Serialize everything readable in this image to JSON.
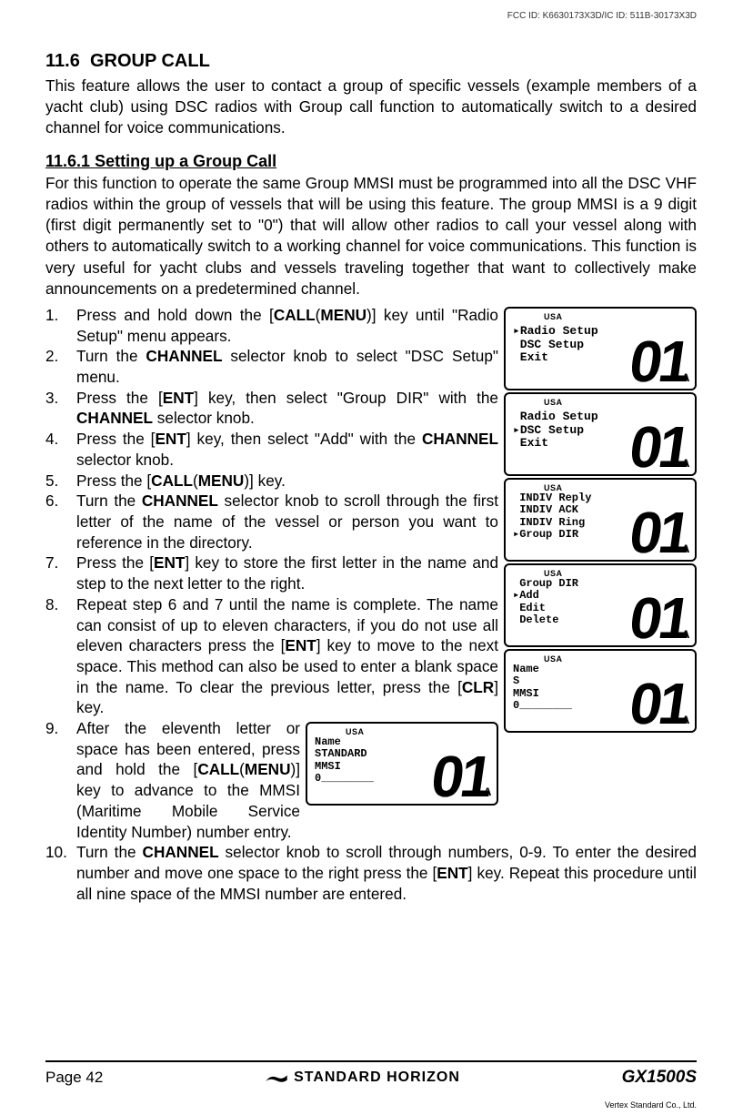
{
  "fcc_id": "FCC ID: K6630173X3D/IC ID: 511B-30173X3D",
  "section": {
    "number": "11.6",
    "title": "GROUP CALL",
    "intro": "This feature allows the user to contact a group of specific vessels (example members of a yacht club) using DSC radios with Group call function to automatically switch to a desired channel for voice communications."
  },
  "subsection": {
    "number": "11.6.1",
    "title": "Setting up a Group Call",
    "intro": "For this function to operate the same Group MMSI must be programmed into all the DSC VHF radios within the group of vessels that will be using this feature. The group MMSI is a 9 digit (first digit permanently set to \"0\") that will allow other radios to call your vessel along with others to automatically switch to a working channel for voice communications. This function is very useful for yacht clubs and vessels traveling together that want to collectively make announcements on a predetermined channel."
  },
  "keys": {
    "call_menu": "CALL",
    "menu_paren": "MENU",
    "ent": "ENT",
    "channel": "CHANNEL",
    "clr": "CLR"
  },
  "menu_labels": {
    "radio_setup": "Radio Setup",
    "dsc_setup": "DSC Setup",
    "group_dir": "Group DIR",
    "add": "Add"
  },
  "steps": {
    "s1a": "Press and hold down the [",
    "s1b": ")] key until \"",
    "s1c": "\" menu appears.",
    "s2a": "Turn the ",
    "s2b": " selector knob to select \"",
    "s2c": "\" menu.",
    "s3a": "Press the [",
    "s3b": "] key, then select \"",
    "s3c": "\" with the ",
    "s3d": " selector knob.",
    "s4a": "Press the [",
    "s4b": "] key, then select \"",
    "s4c": "\" with the ",
    "s4d": " selector knob.",
    "s5a": "Press the [",
    "s5b": ")] key.",
    "s6a": "Turn the ",
    "s6b": " selector knob to scroll through the first letter of the name of the vessel or person you want to reference in the directory.",
    "s7a": "Press the [",
    "s7b": "] key to store the first letter in the name and step to the next letter to the right.",
    "s8a": "Repeat step 6 and 7 until the name is complete. The name can consist of up to eleven characters, if you do not use all eleven characters press the [",
    "s8b": "] key to move to the next space. This method can also be used to enter a blank space in the name. To clear the previous letter, press the [",
    "s8c": "] key.",
    "s9a": "After the eleventh letter or space has been entered, press and hold the [",
    "s9b": ")] key to advance to the MMSI (Maritime Mobile Service Identity Number) number entry.",
    "s10a": "Turn the ",
    "s10b": " selector knob to scroll through numbers, 0-9. To enter the desired number and move one space to the right press the [",
    "s10c": "] key. Repeat this procedure until all nine space of the MMSI number are entered.",
    "wide10": "10."
  },
  "lcd": {
    "usa": "USA",
    "big": "01",
    "a": "A",
    "screen1": "▸Radio Setup\n DSC Setup\n Exit",
    "screen2": " Radio Setup\n▸DSC Setup\n Exit",
    "screen3": " INDIV Reply\n INDIV ACK\n INDIV Ring\n▸Group DIR",
    "screen4": " Group DIR\n▸Add\n Edit\n Delete",
    "screen5": "Name\nS\nMMSI\n0________",
    "screen6": "Name\nSTANDARD\nMMSI\n0________"
  },
  "footer": {
    "page": "Page 42",
    "brand": "STANDARD HORIZON",
    "model": "GX1500S",
    "vertex": "Vertex Standard Co., Ltd."
  }
}
